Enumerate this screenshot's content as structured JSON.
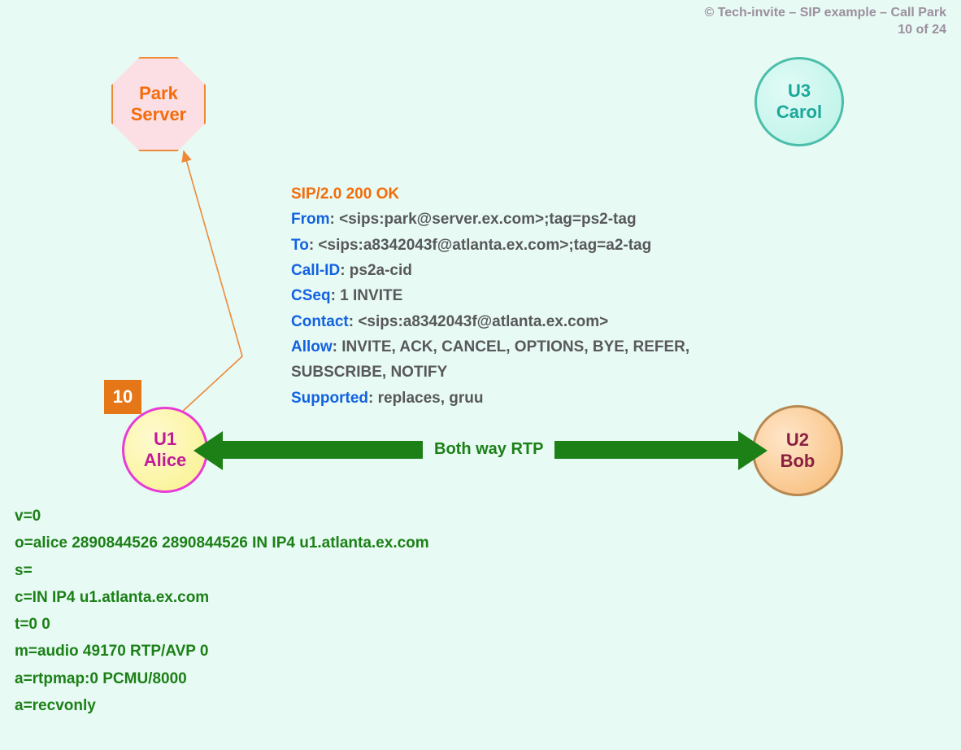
{
  "copyright": {
    "line1": "© Tech-invite – SIP example – Call Park",
    "line2": "10 of 24"
  },
  "nodes": {
    "park_server": {
      "line1": "Park",
      "line2": "Server"
    },
    "alice": {
      "line1": "U1",
      "line2": "Alice"
    },
    "bob": {
      "line1": "U2",
      "line2": "Bob"
    },
    "carol": {
      "line1": "U3",
      "line2": "Carol"
    }
  },
  "step_number": "10",
  "rtp_label": "Both way RTP",
  "sip": {
    "status": "SIP/2.0 200 OK",
    "headers": {
      "from_k": "From",
      "from_v": ": <sips:park@server.ex.com>;tag=ps2-tag",
      "to_k": "To",
      "to_v": ": <sips:a8342043f@atlanta.ex.com>;tag=a2-tag",
      "callid_k": "Call-ID",
      "callid_v": ": ps2a-cid",
      "cseq_k": "CSeq",
      "cseq_v": ": 1 INVITE",
      "contact_k": "Contact",
      "contact_v": ": <sips:a8342043f@atlanta.ex.com>",
      "allow_k": "Allow",
      "allow_v": ": INVITE, ACK, CANCEL, OPTIONS, BYE, REFER,",
      "allow_v2": " SUBSCRIBE, NOTIFY",
      "supported_k": "Supported",
      "supported_v": ": replaces, gruu"
    }
  },
  "sdp": {
    "l1": "v=0",
    "l2": "o=alice  2890844526  2890844526  IN  IP4  u1.atlanta.ex.com",
    "l3": "s=",
    "l4": "c=IN  IP4  u1.atlanta.ex.com",
    "l5": "t=0  0",
    "l6": "m=audio  49170  RTP/AVP  0",
    "l7": "a=rtpmap:0  PCMU/8000",
    "l8": "a=recvonly"
  }
}
